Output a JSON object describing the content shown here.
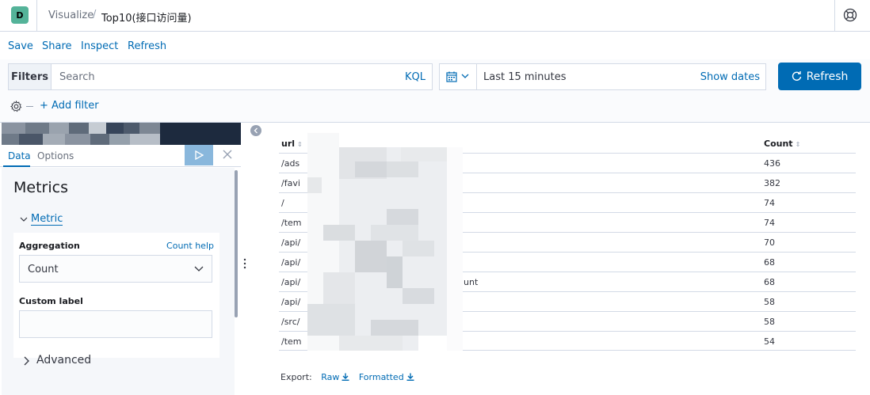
{
  "header": {
    "avatar_letter": "D",
    "breadcrumb_app": "Visualize",
    "breadcrumb_separator": "/",
    "breadcrumb_title": "Top10(接口访问量)"
  },
  "menu": {
    "save": "Save",
    "share": "Share",
    "inspect": "Inspect",
    "refresh": "Refresh"
  },
  "query": {
    "filters_label": "Filters",
    "search_placeholder": "Search",
    "kql": "KQL",
    "time_range": "Last 15 minutes",
    "show_dates": "Show dates",
    "refresh_button": "Refresh",
    "add_filter": "+ Add filter"
  },
  "sidebar": {
    "tabs": [
      {
        "label": "Data",
        "active": true
      },
      {
        "label": "Options",
        "active": false
      }
    ],
    "metrics_title": "Metrics",
    "metric_label": "Metric",
    "aggregation_label": "Aggregation",
    "count_help": "Count help",
    "aggregation_value": "Count",
    "custom_label": "Custom label",
    "custom_label_value": "",
    "advanced": "Advanced"
  },
  "table": {
    "columns": [
      "url",
      "Count"
    ],
    "rows": [
      {
        "url": "/ads",
        "count": "436"
      },
      {
        "url": "/favi",
        "count": "382"
      },
      {
        "url": "/",
        "count": "74"
      },
      {
        "url": "/tem",
        "count": "74"
      },
      {
        "url": "/api/",
        "count": "70"
      },
      {
        "url": "/api/",
        "count": "68"
      },
      {
        "url": "/api/",
        "suffix": "unt",
        "count": "68"
      },
      {
        "url": "/api/",
        "count": "58"
      },
      {
        "url": "/src/",
        "count": "58"
      },
      {
        "url": "/tem",
        "count": "54"
      }
    ],
    "export_label": "Export:",
    "export_raw": "Raw",
    "export_formatted": "Formatted"
  },
  "colors": {
    "accent": "#006bb4",
    "avatar": "#54b399",
    "index_bar": "#1d2a3e"
  }
}
